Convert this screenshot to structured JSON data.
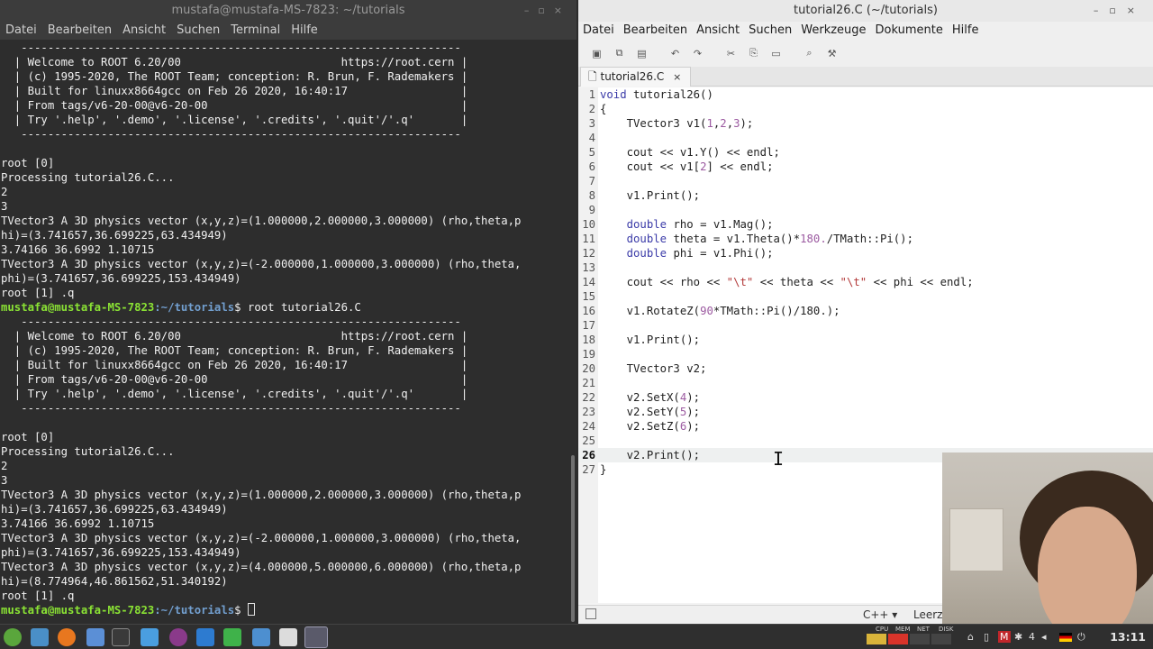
{
  "terminal": {
    "title": "mustafa@mustafa-MS-7823: ~/tutorials",
    "menu": [
      "Datei",
      "Bearbeiten",
      "Ansicht",
      "Suchen",
      "Terminal",
      "Hilfe"
    ],
    "prompt_user": "mustafa@mustafa-MS-7823",
    "prompt_path": ":~/tutorials",
    "lines": [
      "   ------------------------------------------------------------------",
      "  | Welcome to ROOT 6.20/00                        https://root.cern |",
      "  | (c) 1995-2020, The ROOT Team; conception: R. Brun, F. Rademakers |",
      "  | Built for linuxx8664gcc on Feb 26 2020, 16:40:17                 |",
      "  | From tags/v6-20-00@v6-20-00                                      |",
      "  | Try '.help', '.demo', '.license', '.credits', '.quit'/'.q'       |",
      "   ------------------------------------------------------------------",
      "",
      "root [0]",
      "Processing tutorial26.C...",
      "2",
      "3",
      "TVector3 A 3D physics vector (x,y,z)=(1.000000,2.000000,3.000000) (rho,theta,p",
      "hi)=(3.741657,36.699225,63.434949)",
      "3.74166 36.6992 1.10715",
      "TVector3 A 3D physics vector (x,y,z)=(-2.000000,1.000000,3.000000) (rho,theta,",
      "phi)=(3.741657,36.699225,153.434949)",
      "root [1] .q",
      "$ root tutorial26.C",
      "   ------------------------------------------------------------------",
      "  | Welcome to ROOT 6.20/00                        https://root.cern |",
      "  | (c) 1995-2020, The ROOT Team; conception: R. Brun, F. Rademakers |",
      "  | Built for linuxx8664gcc on Feb 26 2020, 16:40:17                 |",
      "  | From tags/v6-20-00@v6-20-00                                      |",
      "  | Try '.help', '.demo', '.license', '.credits', '.quit'/'.q'       |",
      "   ------------------------------------------------------------------",
      "",
      "root [0]",
      "Processing tutorial26.C...",
      "2",
      "3",
      "TVector3 A 3D physics vector (x,y,z)=(1.000000,2.000000,3.000000) (rho,theta,p",
      "hi)=(3.741657,36.699225,63.434949)",
      "3.74166 36.6992 1.10715",
      "TVector3 A 3D physics vector (x,y,z)=(-2.000000,1.000000,3.000000) (rho,theta,",
      "phi)=(3.741657,36.699225,153.434949)",
      "TVector3 A 3D physics vector (x,y,z)=(4.000000,5.000000,6.000000) (rho,theta,p",
      "hi)=(8.774964,46.861562,51.340192)",
      "root [1] .q",
      "$ "
    ]
  },
  "editor": {
    "title": "tutorial26.C (~/tutorials)",
    "menu": [
      "Datei",
      "Bearbeiten",
      "Ansicht",
      "Suchen",
      "Werkzeuge",
      "Dokumente",
      "Hilfe"
    ],
    "toolbar": [
      "new-file-icon",
      "new-window-icon",
      "save-icon",
      "undo-icon",
      "redo-icon",
      "cut-icon",
      "copy-icon",
      "paste-icon",
      "search-icon",
      "replace-icon"
    ],
    "tab_label": "tutorial26.C",
    "code": [
      "void tutorial26()",
      "{",
      "    TVector3 v1(1,2,3);",
      "",
      "    cout << v1.Y() << endl;",
      "    cout << v1[2] << endl;",
      "",
      "    v1.Print();",
      "",
      "    double rho = v1.Mag();",
      "    double theta = v1.Theta()*180./TMath::Pi();",
      "    double phi = v1.Phi();",
      "",
      "    cout << rho << \"\\t\" << theta << \"\\t\" << phi << endl;",
      "",
      "    v1.RotateZ(90*TMath::Pi()/180.);",
      "",
      "    v1.Print();",
      "",
      "    TVector3 v2;",
      "",
      "    v2.SetX(4);",
      "    v2.SetY(5);",
      "    v2.SetZ(6);",
      "",
      "    v2.Print();",
      "}"
    ],
    "current_line": 26,
    "status_language": "C++ ▾",
    "status_indent": "Leerzeic"
  },
  "taskbar": {
    "tray_labels": [
      "CPU",
      "MEM",
      "NET",
      "DISK"
    ],
    "workspace": "4",
    "clock": "13:11"
  }
}
